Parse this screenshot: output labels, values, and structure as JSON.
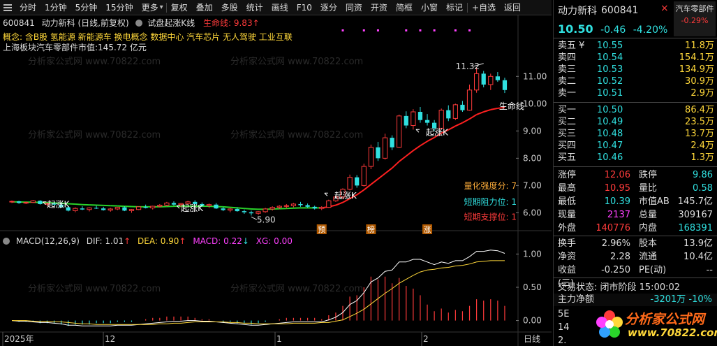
{
  "toolbar": {
    "items": [
      "分时",
      "1分钟",
      "5分钟",
      "15分钟",
      "更多",
      "复权",
      "叠加",
      "多股",
      "统计",
      "画线",
      "F10",
      "逐分",
      "同资",
      "开资",
      "简框",
      "小窗",
      "标记",
      "+自选",
      "返回"
    ]
  },
  "chart": {
    "code": "600841",
    "name_mode": "动力新科 (日线,前复权)",
    "indicator": "试盘起涨K线",
    "life_line_label": "生命线: 9.83",
    "concepts": "概念: 含B股 氢能源 新能源车 换电概念 数据中心 汽车芯片 无人驾驶 工业互联",
    "sector_value": "上海板块汽车零部件市值:145.72 亿元",
    "watermark": "分析家公式网 www.70822.com",
    "annotations": {
      "high": "11.32",
      "low": "5.90",
      "life_line": "生命线",
      "rise_k": "起涨K",
      "strength": "量化强度分: 7",
      "resist": "短期阻力位: 1",
      "support": "短期支撑位: 1",
      "tag_yu": "预",
      "tag_bang": "榜",
      "tag_zhang": "涨"
    },
    "x_labels": [
      "2025年",
      "12",
      "1",
      "2",
      "日线"
    ],
    "price_axis": [
      "11.00",
      "10.00",
      "9.00",
      "8.00",
      "7.00",
      "6.00"
    ],
    "macd_axis": [
      "1.00",
      "0.50",
      "0.00"
    ]
  },
  "macd": {
    "name": "MACD(12,26,9)",
    "dif": "DIF: 1.01",
    "dea": "DEA: 0.90",
    "macd": "MACD: 0.22",
    "xg": "XG: 0.00"
  },
  "chart_data": {
    "type": "candlestick",
    "y_range": [
      5.55,
      11.75
    ],
    "candles": [
      [
        6.4,
        6.45,
        6.36,
        6.42
      ],
      [
        6.42,
        6.44,
        6.33,
        6.36
      ],
      [
        6.36,
        6.41,
        6.32,
        6.38
      ],
      [
        6.38,
        6.47,
        6.36,
        6.44
      ],
      [
        6.44,
        6.46,
        6.3,
        6.32
      ],
      [
        6.32,
        6.38,
        6.24,
        6.34
      ],
      [
        6.34,
        6.4,
        6.28,
        6.3
      ],
      [
        6.3,
        6.36,
        6.18,
        6.2
      ],
      [
        6.2,
        6.26,
        6.05,
        6.08
      ],
      [
        6.08,
        6.2,
        6.02,
        6.16
      ],
      [
        6.16,
        6.24,
        6.1,
        6.12
      ],
      [
        6.12,
        6.2,
        6.05,
        6.18
      ],
      [
        6.18,
        6.26,
        6.14,
        6.16
      ],
      [
        6.16,
        6.22,
        6.08,
        6.1
      ],
      [
        6.1,
        6.18,
        6.04,
        6.14
      ],
      [
        6.14,
        6.22,
        6.1,
        6.2
      ],
      [
        6.2,
        6.24,
        6.06,
        6.08
      ],
      [
        6.08,
        6.14,
        6.0,
        6.12
      ],
      [
        6.12,
        6.24,
        6.1,
        6.22
      ],
      [
        6.22,
        6.3,
        6.16,
        6.18
      ],
      [
        6.18,
        6.26,
        6.12,
        6.24
      ],
      [
        6.24,
        6.32,
        6.2,
        6.28
      ],
      [
        6.28,
        6.4,
        6.24,
        6.36
      ],
      [
        6.36,
        6.42,
        6.26,
        6.3
      ],
      [
        6.3,
        6.36,
        6.2,
        6.34
      ],
      [
        6.34,
        6.44,
        6.3,
        6.4
      ],
      [
        6.4,
        6.46,
        6.28,
        6.32
      ],
      [
        6.32,
        6.38,
        6.22,
        6.26
      ],
      [
        6.26,
        6.34,
        6.18,
        6.3
      ],
      [
        6.3,
        6.36,
        6.14,
        6.16
      ],
      [
        6.16,
        6.22,
        6.06,
        6.1
      ],
      [
        6.1,
        6.18,
        6.02,
        6.14
      ],
      [
        6.14,
        6.2,
        6.04,
        6.06
      ],
      [
        6.06,
        6.12,
        5.96,
        6.02
      ],
      [
        6.02,
        6.08,
        5.9,
        5.98
      ],
      [
        5.98,
        6.06,
        5.92,
        6.04
      ],
      [
        6.04,
        6.18,
        6.0,
        6.14
      ],
      [
        6.14,
        6.24,
        6.08,
        6.2
      ],
      [
        6.2,
        6.28,
        6.14,
        6.24
      ],
      [
        6.24,
        6.32,
        6.16,
        6.26
      ],
      [
        6.26,
        6.36,
        6.2,
        6.32
      ],
      [
        6.32,
        6.4,
        6.22,
        6.28
      ],
      [
        6.28,
        6.34,
        6.18,
        6.22
      ],
      [
        6.22,
        6.26,
        6.12,
        6.16
      ],
      [
        6.16,
        6.24,
        6.1,
        6.2
      ],
      [
        6.2,
        6.48,
        6.18,
        6.44
      ],
      [
        6.44,
        6.62,
        6.4,
        6.58
      ],
      [
        6.58,
        6.9,
        6.5,
        6.86
      ],
      [
        6.86,
        7.4,
        6.82,
        7.3
      ],
      [
        7.3,
        7.38,
        6.92,
        7.0
      ],
      [
        7.0,
        7.8,
        6.96,
        7.7
      ],
      [
        7.7,
        8.5,
        7.6,
        8.4
      ],
      [
        8.4,
        8.6,
        7.9,
        8.0
      ],
      [
        8.0,
        8.9,
        7.95,
        8.75
      ],
      [
        8.75,
        8.84,
        8.3,
        8.4
      ],
      [
        8.4,
        9.6,
        8.38,
        9.55
      ],
      [
        9.55,
        9.72,
        9.1,
        9.2
      ],
      [
        9.2,
        9.8,
        9.05,
        9.7
      ],
      [
        9.7,
        9.88,
        9.3,
        9.4
      ],
      [
        9.4,
        9.62,
        9.2,
        9.3
      ],
      [
        9.3,
        9.4,
        9.0,
        9.1
      ],
      [
        9.1,
        9.82,
        9.05,
        9.76
      ],
      [
        9.76,
        9.94,
        9.36,
        9.46
      ],
      [
        9.46,
        10.0,
        9.4,
        9.96
      ],
      [
        9.96,
        10.1,
        9.7,
        9.76
      ],
      [
        9.76,
        10.7,
        9.74,
        10.5
      ],
      [
        10.5,
        11.32,
        10.4,
        11.1
      ],
      [
        11.1,
        11.2,
        10.6,
        10.7
      ],
      [
        10.7,
        11.1,
        10.5,
        11.0
      ],
      [
        11.0,
        11.16,
        10.8,
        10.86
      ],
      [
        10.86,
        10.95,
        10.39,
        10.5
      ]
    ],
    "life_line": [
      6.4,
      6.4,
      6.39,
      6.39,
      6.38,
      6.37,
      6.36,
      6.35,
      6.33,
      6.32,
      6.3,
      6.29,
      6.28,
      6.27,
      6.26,
      6.25,
      6.24,
      6.23,
      6.22,
      6.22,
      6.22,
      6.22,
      6.23,
      6.24,
      6.24,
      6.24,
      6.24,
      6.24,
      6.24,
      6.23,
      6.22,
      6.2,
      6.18,
      6.16,
      6.14,
      6.13,
      6.13,
      6.14,
      6.15,
      6.16,
      6.17,
      6.18,
      6.18,
      6.18,
      6.18,
      6.22,
      6.28,
      6.38,
      6.52,
      6.66,
      6.84,
      7.04,
      7.24,
      7.44,
      7.64,
      7.88,
      8.08,
      8.28,
      8.46,
      8.62,
      8.76,
      8.92,
      9.04,
      9.18,
      9.3,
      9.44,
      9.6,
      9.7,
      9.78,
      9.83,
      9.86
    ],
    "dif": [
      0.0,
      -0.01,
      -0.01,
      -0.02,
      -0.03,
      -0.03,
      -0.04,
      -0.05,
      -0.07,
      -0.07,
      -0.08,
      -0.08,
      -0.08,
      -0.08,
      -0.08,
      -0.07,
      -0.07,
      -0.07,
      -0.06,
      -0.05,
      -0.04,
      -0.03,
      -0.02,
      -0.01,
      -0.01,
      0.0,
      0.0,
      -0.01,
      -0.01,
      -0.02,
      -0.03,
      -0.04,
      -0.05,
      -0.06,
      -0.07,
      -0.07,
      -0.06,
      -0.05,
      -0.04,
      -0.03,
      -0.02,
      -0.02,
      -0.02,
      -0.02,
      -0.02,
      0.01,
      0.05,
      0.12,
      0.24,
      0.3,
      0.42,
      0.58,
      0.64,
      0.74,
      0.76,
      0.88,
      0.88,
      0.92,
      0.92,
      0.88,
      0.84,
      0.88,
      0.86,
      0.9,
      0.9,
      0.96,
      1.04,
      1.04,
      1.06,
      1.05,
      1.01
    ],
    "dea": [
      0.0,
      0.0,
      0.0,
      -0.01,
      -0.01,
      -0.01,
      -0.02,
      -0.02,
      -0.03,
      -0.04,
      -0.05,
      -0.05,
      -0.06,
      -0.06,
      -0.06,
      -0.06,
      -0.06,
      -0.06,
      -0.06,
      -0.06,
      -0.06,
      -0.05,
      -0.05,
      -0.04,
      -0.04,
      -0.03,
      -0.02,
      -0.02,
      -0.02,
      -0.02,
      -0.02,
      -0.03,
      -0.03,
      -0.04,
      -0.04,
      -0.05,
      -0.05,
      -0.05,
      -0.05,
      -0.05,
      -0.04,
      -0.04,
      -0.04,
      -0.04,
      -0.03,
      -0.03,
      -0.01,
      0.01,
      0.06,
      0.11,
      0.17,
      0.25,
      0.33,
      0.41,
      0.48,
      0.56,
      0.62,
      0.68,
      0.73,
      0.76,
      0.77,
      0.79,
      0.8,
      0.82,
      0.83,
      0.85,
      0.88,
      0.89,
      0.9,
      0.9,
      0.9
    ]
  },
  "panel": {
    "stock_name": "动力新科",
    "stock_code": "600841",
    "close_symbol": "×",
    "sector_tag": "汽车零部件",
    "sector_pct": "-0.29%",
    "price": "10.50",
    "change": "-0.46",
    "change_pct": "-4.20%",
    "asks": [
      {
        "label": "卖五 ¥",
        "price": "10.55",
        "vol": "11.8万"
      },
      {
        "label": "卖四",
        "price": "10.54",
        "vol": "154.1万"
      },
      {
        "label": "卖三",
        "price": "10.53",
        "vol": "134.9万"
      },
      {
        "label": "卖二",
        "price": "10.52",
        "vol": "30.9万"
      },
      {
        "label": "卖一",
        "price": "10.51",
        "vol": "2.9万"
      }
    ],
    "bids": [
      {
        "label": "买一",
        "price": "10.50",
        "vol": "86.4万"
      },
      {
        "label": "买二",
        "price": "10.49",
        "vol": "23.5万"
      },
      {
        "label": "买三",
        "price": "10.48",
        "vol": "13.7万"
      },
      {
        "label": "买四",
        "price": "10.47",
        "vol": "2.4万"
      },
      {
        "label": "买五",
        "price": "10.46",
        "vol": "1.3万"
      }
    ],
    "stats1": [
      {
        "l1": "涨停",
        "v1": "12.06",
        "c1": "red",
        "l2": "跌停",
        "v2": "9.86",
        "c2": "cyan"
      },
      {
        "l1": "最高",
        "v1": "10.95",
        "c1": "red",
        "l2": "量比",
        "v2": "0.58",
        "c2": "cyan"
      },
      {
        "l1": "最低",
        "v1": "10.39",
        "c1": "cyan",
        "l2": "市值AB",
        "v2": "145.7亿",
        "c2": "wht"
      },
      {
        "l1": "现量",
        "v1": "2137",
        "c1": "mag",
        "l2": "总量",
        "v2": "309167",
        "c2": "wht"
      },
      {
        "l1": "外盘",
        "v1": "140776",
        "c1": "red",
        "l2": "内盘",
        "v2": "168391",
        "c2": "cyan"
      }
    ],
    "stats2": [
      {
        "l1": "换手",
        "v1": "2.96%",
        "c1": "wht",
        "l2": "股本",
        "v2": "13.9亿",
        "c2": "wht"
      },
      {
        "l1": "净资",
        "v1": "2.28",
        "c1": "wht",
        "l2": "流通",
        "v2": "10.4亿",
        "c2": "wht"
      },
      {
        "l1": "收益(三)",
        "v1": "-0.250",
        "c1": "wht",
        "l2": "PE(动)",
        "v2": "--",
        "c2": "wht"
      }
    ],
    "trade_state": "交易状态: 闭市阶段 15:00:02",
    "main_net_label": "主力净额",
    "main_net_value": "-3201万 -10%",
    "side_frag": [
      "5E",
      "14",
      "2.",
      ""
    ],
    "logo_cn": "分析家公式网",
    "logo_url": "www.70822.com"
  },
  "colors": {
    "up": "#ff3b3b",
    "down": "#30e0e0",
    "life_up": "#ff2020",
    "life_flat": "#2ad42a",
    "dif": "#ffffff",
    "dea": "#ffd83a",
    "macd_bar": "#ff3b3b"
  }
}
